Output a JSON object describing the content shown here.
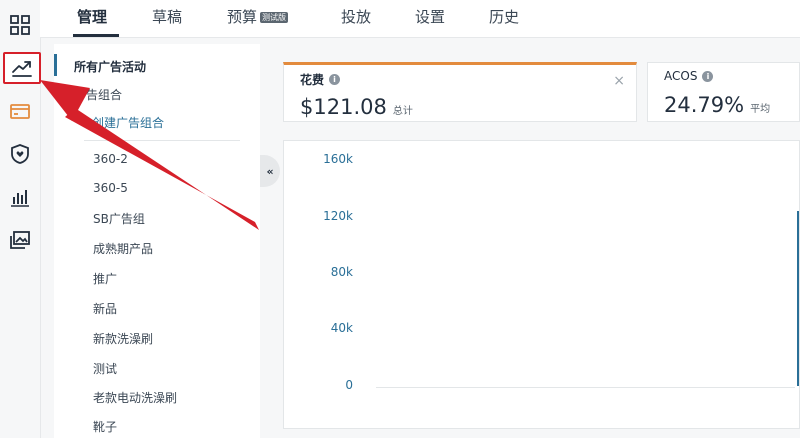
{
  "rail": {
    "items": [
      {
        "icon": "dashboard-grid-icon"
      },
      {
        "icon": "trending-up-icon",
        "active": true
      },
      {
        "icon": "card-icon"
      },
      {
        "icon": "shield-heart-icon"
      },
      {
        "icon": "bar-chart-icon"
      },
      {
        "icon": "image-gallery-icon"
      }
    ]
  },
  "nav": {
    "tabs": [
      "管理",
      "草稿",
      "预算",
      "投放",
      "设置",
      "历史"
    ],
    "active": "管理",
    "budget_badge": "测试版"
  },
  "sidebar": {
    "title": "所有广告活动",
    "group_label": "广告组合",
    "create_label": "创建广告组合",
    "items": [
      "360-2",
      "360-5",
      "SB广告组",
      "成熟期产品",
      "推广",
      "新品",
      "新款洗澡刷",
      "测试",
      "老款电动洗澡刷",
      "靴子"
    ]
  },
  "collapse_label": "«",
  "cards": {
    "spend": {
      "label": "花费",
      "value": "$121.08",
      "sub": "总计",
      "close": "×"
    },
    "acos": {
      "label": "ACOS",
      "value": "24.79%",
      "sub": "平均"
    }
  },
  "chart_data": {
    "type": "line",
    "yticks": [
      "160k",
      "120k",
      "80k",
      "40k",
      "0"
    ],
    "ylim": [
      0,
      160000
    ]
  },
  "colors": {
    "accent_blue": "#2a6f97",
    "spend_orange": "#e38b3d",
    "annotation_red": "#d6202a"
  }
}
